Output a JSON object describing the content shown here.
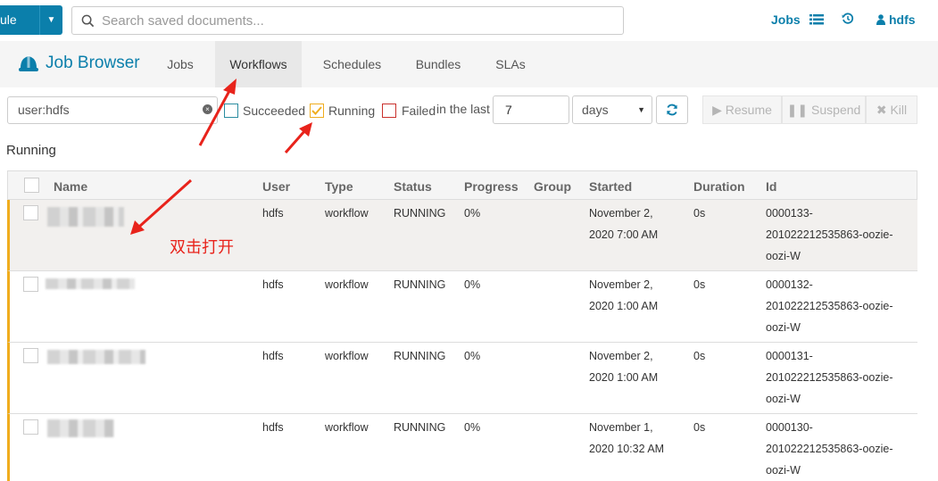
{
  "topbar": {
    "main_button_label": "ule",
    "search_placeholder": "Search saved documents...",
    "jobs_label": "Jobs",
    "user_label": "hdfs"
  },
  "app": {
    "title": "Job Browser",
    "tabs": [
      {
        "label": "Jobs",
        "active": false
      },
      {
        "label": "Workflows",
        "active": true
      },
      {
        "label": "Schedules",
        "active": false
      },
      {
        "label": "Bundles",
        "active": false
      },
      {
        "label": "SLAs",
        "active": false
      }
    ]
  },
  "filters": {
    "text": "user:hdfs",
    "succeeded_label": "Succeeded",
    "succeeded_checked": false,
    "running_label": "Running",
    "running_checked": true,
    "failed_label": "Failed",
    "failed_checked": false,
    "in_the_last_label": "in the last",
    "days_value": "7",
    "days_unit": "days",
    "resume_label": "Resume",
    "suspend_label": "Suspend",
    "kill_label": "Kill"
  },
  "section_title": "Running",
  "table": {
    "headers": [
      "Name",
      "User",
      "Type",
      "Status",
      "Progress",
      "Group",
      "Started",
      "Duration",
      "Id"
    ],
    "rows": [
      {
        "user": "hdfs",
        "type": "workflow",
        "status": "RUNNING",
        "progress": "0%",
        "group": "",
        "started_1": "November 2,",
        "started_2": "2020 7:00 AM",
        "duration": "0s",
        "id_1": "0000133-",
        "id_2": "201022212535863-oozie-",
        "id_3": "oozi-W"
      },
      {
        "user": "hdfs",
        "type": "workflow",
        "status": "RUNNING",
        "progress": "0%",
        "group": "",
        "started_1": "November 2,",
        "started_2": "2020 1:00 AM",
        "duration": "0s",
        "id_1": "0000132-",
        "id_2": "201022212535863-oozie-",
        "id_3": "oozi-W"
      },
      {
        "user": "hdfs",
        "type": "workflow",
        "status": "RUNNING",
        "progress": "0%",
        "group": "",
        "started_1": "November 2,",
        "started_2": "2020 1:00 AM",
        "duration": "0s",
        "id_1": "0000131-",
        "id_2": "201022212535863-oozie-",
        "id_3": "oozi-W"
      },
      {
        "user": "hdfs",
        "type": "workflow",
        "status": "RUNNING",
        "progress": "0%",
        "group": "",
        "started_1": "November 1,",
        "started_2": "2020 10:32 AM",
        "duration": "0s",
        "id_1": "0000130-",
        "id_2": "201022212535863-oozie-",
        "id_3": "oozi-W"
      }
    ]
  },
  "annotation_text": "双击打开",
  "colors": {
    "brand": "#0b7fab",
    "row_accent": "#f0ad1e",
    "annotation": "#e8231b",
    "running_checkbox": "#f0ad1e",
    "failed_checkbox": "#c9302c",
    "succeeded_checkbox": "#2a8ca0"
  }
}
